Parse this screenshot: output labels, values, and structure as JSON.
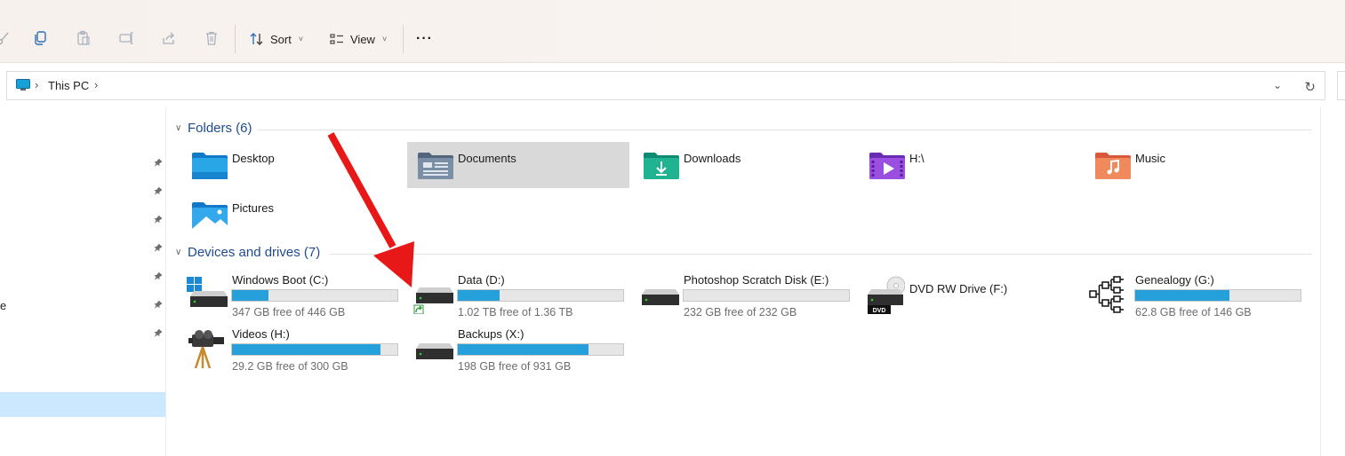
{
  "toolbar": {
    "sort_label": "Sort",
    "view_label": "View",
    "more_label": "···"
  },
  "address": {
    "location": "This PC"
  },
  "folders_section": {
    "title": "Folders (6)",
    "items": [
      {
        "name": "Desktop",
        "icon": "desktop-folder-icon",
        "selected": false
      },
      {
        "name": "Documents",
        "icon": "documents-folder-icon",
        "selected": true
      },
      {
        "name": "Downloads",
        "icon": "downloads-folder-icon",
        "selected": false
      },
      {
        "name": "H:\\",
        "icon": "videos-folder-icon",
        "selected": false
      },
      {
        "name": "Music",
        "icon": "music-folder-icon",
        "selected": false
      },
      {
        "name": "Pictures",
        "icon": "pictures-folder-icon",
        "selected": false
      }
    ]
  },
  "drives_section": {
    "title": "Devices and drives (7)",
    "items": [
      {
        "name": "Windows Boot (C:)",
        "free": "347 GB free of 446 GB",
        "used_fraction": 0.22,
        "icon": "windows-drive-icon"
      },
      {
        "name": "Data (D:)",
        "free": "1.02 TB free of 1.36 TB",
        "used_fraction": 0.25,
        "icon": "hard-drive-shortcut-icon"
      },
      {
        "name": "Photoshop Scratch Disk (E:)",
        "free": "232 GB free of 232 GB",
        "used_fraction": 0.0,
        "icon": "hard-drive-icon"
      },
      {
        "name": "DVD RW Drive (F:)",
        "free": "",
        "used_fraction": null,
        "icon": "dvd-drive-icon"
      },
      {
        "name": "Genealogy (G:)",
        "free": "62.8 GB free of 146 GB",
        "used_fraction": 0.57,
        "icon": "family-tree-icon"
      },
      {
        "name": "Videos (H:)",
        "free": "29.2 GB free of 300 GB",
        "used_fraction": 0.9,
        "icon": "camera-tripod-icon"
      },
      {
        "name": "Backups (X:)",
        "free": "198 GB free of 931 GB",
        "used_fraction": 0.79,
        "icon": "hard-drive-icon"
      }
    ]
  },
  "nav": {
    "partial_label": "e"
  },
  "colors": {
    "section_title": "#1f4b8e",
    "bar_fill": "#26a0da",
    "annotation_arrow": "#e81818",
    "nav_selected": "#cce8ff"
  }
}
